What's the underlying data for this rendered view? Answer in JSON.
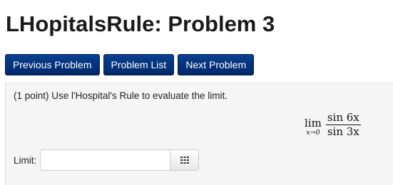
{
  "page": {
    "title": "LHopitalsRule: Problem 3"
  },
  "nav": {
    "previous_label": "Previous Problem",
    "list_label": "Problem List",
    "next_label": "Next Problem"
  },
  "problem": {
    "text": "(1 point) Use l'Hospital's Rule to evaluate the limit.",
    "math": {
      "lim": "lim",
      "subscript": "x→0",
      "numerator": "sin 6x",
      "denominator": "sin 3x"
    },
    "answer": {
      "label": "Limit:",
      "value": "",
      "placeholder": ""
    },
    "palette_icon": "grid-icon"
  },
  "colors": {
    "nav_button": "#00337f",
    "panel_background": "#f5f5f5"
  }
}
